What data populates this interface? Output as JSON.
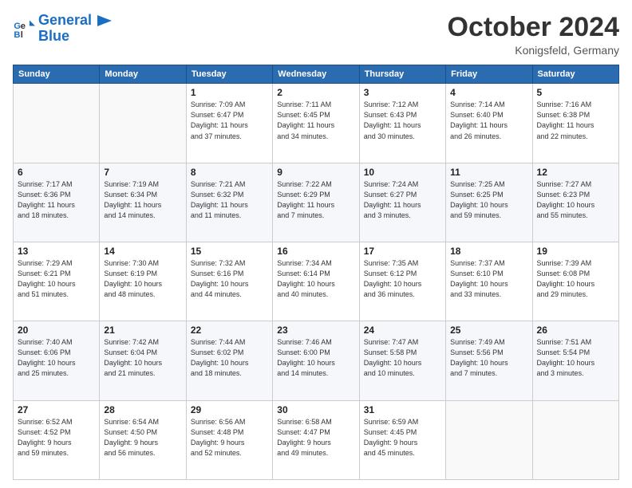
{
  "logo": {
    "line1": "General",
    "line2": "Blue"
  },
  "header": {
    "title": "October 2024",
    "location": "Konigsfeld, Germany"
  },
  "days_of_week": [
    "Sunday",
    "Monday",
    "Tuesday",
    "Wednesday",
    "Thursday",
    "Friday",
    "Saturday"
  ],
  "weeks": [
    [
      {
        "day": "",
        "text": ""
      },
      {
        "day": "",
        "text": ""
      },
      {
        "day": "1",
        "text": "Sunrise: 7:09 AM\nSunset: 6:47 PM\nDaylight: 11 hours\nand 37 minutes."
      },
      {
        "day": "2",
        "text": "Sunrise: 7:11 AM\nSunset: 6:45 PM\nDaylight: 11 hours\nand 34 minutes."
      },
      {
        "day": "3",
        "text": "Sunrise: 7:12 AM\nSunset: 6:43 PM\nDaylight: 11 hours\nand 30 minutes."
      },
      {
        "day": "4",
        "text": "Sunrise: 7:14 AM\nSunset: 6:40 PM\nDaylight: 11 hours\nand 26 minutes."
      },
      {
        "day": "5",
        "text": "Sunrise: 7:16 AM\nSunset: 6:38 PM\nDaylight: 11 hours\nand 22 minutes."
      }
    ],
    [
      {
        "day": "6",
        "text": "Sunrise: 7:17 AM\nSunset: 6:36 PM\nDaylight: 11 hours\nand 18 minutes."
      },
      {
        "day": "7",
        "text": "Sunrise: 7:19 AM\nSunset: 6:34 PM\nDaylight: 11 hours\nand 14 minutes."
      },
      {
        "day": "8",
        "text": "Sunrise: 7:21 AM\nSunset: 6:32 PM\nDaylight: 11 hours\nand 11 minutes."
      },
      {
        "day": "9",
        "text": "Sunrise: 7:22 AM\nSunset: 6:29 PM\nDaylight: 11 hours\nand 7 minutes."
      },
      {
        "day": "10",
        "text": "Sunrise: 7:24 AM\nSunset: 6:27 PM\nDaylight: 11 hours\nand 3 minutes."
      },
      {
        "day": "11",
        "text": "Sunrise: 7:25 AM\nSunset: 6:25 PM\nDaylight: 10 hours\nand 59 minutes."
      },
      {
        "day": "12",
        "text": "Sunrise: 7:27 AM\nSunset: 6:23 PM\nDaylight: 10 hours\nand 55 minutes."
      }
    ],
    [
      {
        "day": "13",
        "text": "Sunrise: 7:29 AM\nSunset: 6:21 PM\nDaylight: 10 hours\nand 51 minutes."
      },
      {
        "day": "14",
        "text": "Sunrise: 7:30 AM\nSunset: 6:19 PM\nDaylight: 10 hours\nand 48 minutes."
      },
      {
        "day": "15",
        "text": "Sunrise: 7:32 AM\nSunset: 6:16 PM\nDaylight: 10 hours\nand 44 minutes."
      },
      {
        "day": "16",
        "text": "Sunrise: 7:34 AM\nSunset: 6:14 PM\nDaylight: 10 hours\nand 40 minutes."
      },
      {
        "day": "17",
        "text": "Sunrise: 7:35 AM\nSunset: 6:12 PM\nDaylight: 10 hours\nand 36 minutes."
      },
      {
        "day": "18",
        "text": "Sunrise: 7:37 AM\nSunset: 6:10 PM\nDaylight: 10 hours\nand 33 minutes."
      },
      {
        "day": "19",
        "text": "Sunrise: 7:39 AM\nSunset: 6:08 PM\nDaylight: 10 hours\nand 29 minutes."
      }
    ],
    [
      {
        "day": "20",
        "text": "Sunrise: 7:40 AM\nSunset: 6:06 PM\nDaylight: 10 hours\nand 25 minutes."
      },
      {
        "day": "21",
        "text": "Sunrise: 7:42 AM\nSunset: 6:04 PM\nDaylight: 10 hours\nand 21 minutes."
      },
      {
        "day": "22",
        "text": "Sunrise: 7:44 AM\nSunset: 6:02 PM\nDaylight: 10 hours\nand 18 minutes."
      },
      {
        "day": "23",
        "text": "Sunrise: 7:46 AM\nSunset: 6:00 PM\nDaylight: 10 hours\nand 14 minutes."
      },
      {
        "day": "24",
        "text": "Sunrise: 7:47 AM\nSunset: 5:58 PM\nDaylight: 10 hours\nand 10 minutes."
      },
      {
        "day": "25",
        "text": "Sunrise: 7:49 AM\nSunset: 5:56 PM\nDaylight: 10 hours\nand 7 minutes."
      },
      {
        "day": "26",
        "text": "Sunrise: 7:51 AM\nSunset: 5:54 PM\nDaylight: 10 hours\nand 3 minutes."
      }
    ],
    [
      {
        "day": "27",
        "text": "Sunrise: 6:52 AM\nSunset: 4:52 PM\nDaylight: 9 hours\nand 59 minutes."
      },
      {
        "day": "28",
        "text": "Sunrise: 6:54 AM\nSunset: 4:50 PM\nDaylight: 9 hours\nand 56 minutes."
      },
      {
        "day": "29",
        "text": "Sunrise: 6:56 AM\nSunset: 4:48 PM\nDaylight: 9 hours\nand 52 minutes."
      },
      {
        "day": "30",
        "text": "Sunrise: 6:58 AM\nSunset: 4:47 PM\nDaylight: 9 hours\nand 49 minutes."
      },
      {
        "day": "31",
        "text": "Sunrise: 6:59 AM\nSunset: 4:45 PM\nDaylight: 9 hours\nand 45 minutes."
      },
      {
        "day": "",
        "text": ""
      },
      {
        "day": "",
        "text": ""
      }
    ]
  ]
}
